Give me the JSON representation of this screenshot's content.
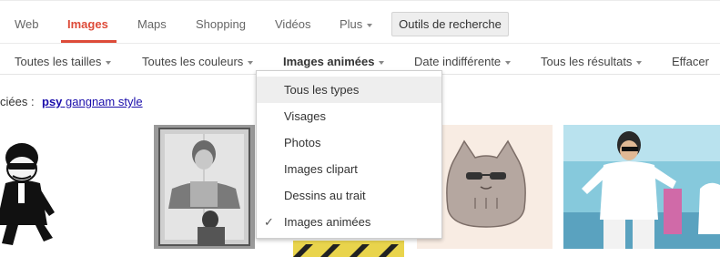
{
  "tabs": [
    {
      "label": "Web"
    },
    {
      "label": "Images"
    },
    {
      "label": "Maps"
    },
    {
      "label": "Shopping"
    },
    {
      "label": "Vidéos"
    },
    {
      "label": "Plus"
    }
  ],
  "tools_button": "Outils de recherche",
  "filters": {
    "size": "Toutes les tailles",
    "color": "Toutes les couleurs",
    "type": "Images animées",
    "date": "Date indifférente",
    "results": "Tous les résultats",
    "clear": "Effacer"
  },
  "related": {
    "label": "ciées :",
    "link_bold": "psy",
    "link_rest": " gangnam style"
  },
  "menu": {
    "items": [
      {
        "label": "Tous les types",
        "highlighted": true,
        "checked": false
      },
      {
        "label": "Visages",
        "highlighted": false,
        "checked": false
      },
      {
        "label": "Photos",
        "highlighted": false,
        "checked": false
      },
      {
        "label": "Images clipart",
        "highlighted": false,
        "checked": false
      },
      {
        "label": "Dessins au trait",
        "highlighted": false,
        "checked": false
      },
      {
        "label": "Images animées",
        "highlighted": false,
        "checked": true
      }
    ],
    "check_glyph": "✓"
  },
  "thumbnails": [
    {
      "subject": "psy-cartoon-dancer"
    },
    {
      "subject": "grayscale-elevator-photo"
    },
    {
      "subject": "yellow-black-pattern"
    },
    {
      "subject": "pusheen-cat-sunglasses"
    },
    {
      "subject": "psy-dancing-photo"
    }
  ],
  "colors": {
    "accent": "#dd4b39",
    "link": "#1a0dab",
    "menu_highlight": "#eeeeee"
  }
}
